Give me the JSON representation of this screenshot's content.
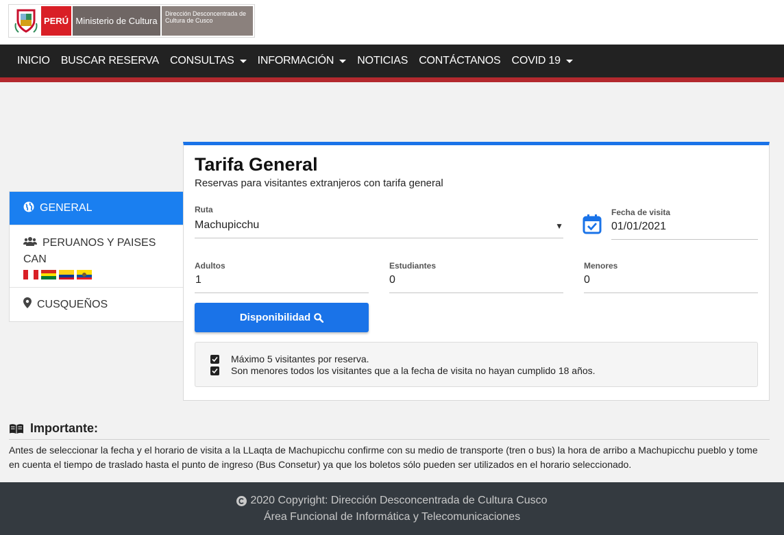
{
  "header": {
    "logo_peru": "PERÚ",
    "logo_ministerio": "Ministerio de Cultura",
    "logo_direccion": "Dirección Desconcentrada de Cultura de Cusco"
  },
  "nav": {
    "items": [
      {
        "label": "INICIO",
        "dropdown": false
      },
      {
        "label": "BUSCAR RESERVA",
        "dropdown": false
      },
      {
        "label": "CONSULTAS",
        "dropdown": true
      },
      {
        "label": "INFORMACIÓN",
        "dropdown": true
      },
      {
        "label": "NOTICIAS",
        "dropdown": false
      },
      {
        "label": "CONTÁCTANOS",
        "dropdown": false
      },
      {
        "label": "COVID 19",
        "dropdown": true
      }
    ]
  },
  "sidebar": {
    "items": [
      {
        "label": "GENERAL",
        "icon": "globe-icon",
        "active": true
      },
      {
        "label": "PERUANOS Y PAISES CAN",
        "icon": "users-icon",
        "active": false,
        "flags": [
          "peru",
          "bolivia",
          "colombia",
          "ecuador"
        ]
      },
      {
        "label": "CUSQUEÑOS",
        "icon": "map-marker-icon",
        "active": false
      }
    ]
  },
  "card": {
    "title": "Tarifa General",
    "subtitle": "Reservas para visitantes extranjeros con tarifa general",
    "ruta_label": "Ruta",
    "ruta_value": "Machupicchu",
    "fecha_label": "Fecha de visita",
    "fecha_value": "01/01/2021",
    "adultos_label": "Adultos",
    "adultos_value": "1",
    "estudiantes_label": "Estudiantes",
    "estudiantes_value": "0",
    "menores_label": "Menores",
    "menores_value": "0",
    "button_label": "Disponibilidad",
    "notes": [
      "Máximo 5 visitantes por reserva.",
      "Son menores todos los visitantes que a la fecha de visita no hayan cumplido 18 años."
    ]
  },
  "importante": {
    "title": "Importante:",
    "text": "Antes de seleccionar la fecha y el horario de visita a la LLaqta de Machupicchu confirme con su medio de transporte (tren o bus) la hora de arribo a Machupicchu pueblo y tome en cuenta el tiempo de traslado hasta el punto de ingreso (Bus Consetur) ya que los boletos sólo pueden ser utilizados en el horario seleccionado."
  },
  "footer": {
    "copyright": "2020 Copyright: Dirección Desconcentrada de Cultura Cusco",
    "area": "Área Funcional de Informática y Telecomunicaciones"
  },
  "colors": {
    "primary": "#1a73e8",
    "navbar": "#222222",
    "nav_accent": "#b3292e",
    "footer": "#343a40"
  }
}
